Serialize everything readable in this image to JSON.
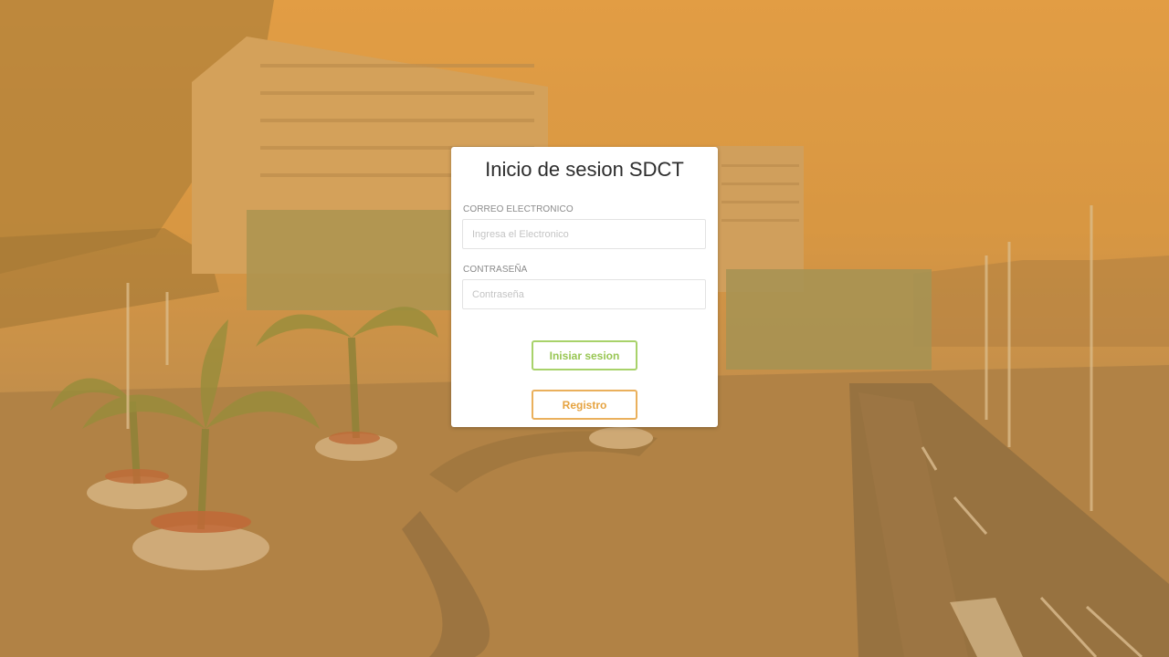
{
  "page": {
    "title": "Inicio de sesion SDCT"
  },
  "form": {
    "email": {
      "label": "CORREO ELECTRONICO",
      "placeholder": "Ingresa el Electronico",
      "value": ""
    },
    "password": {
      "label": "CONTRASEÑA",
      "placeholder": "Contraseña",
      "value": ""
    },
    "login_button": "Inisiar sesion",
    "register_button": "Registro"
  },
  "colors": {
    "overlay": "#e2a04c",
    "login_accent": "#a8d26a",
    "register_accent": "#eab05c"
  }
}
